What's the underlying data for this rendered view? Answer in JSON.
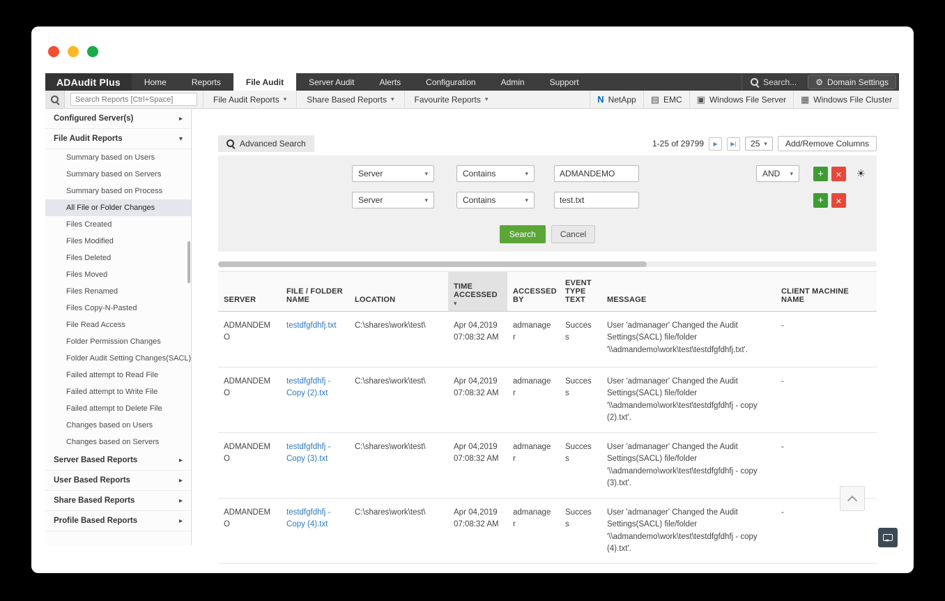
{
  "colors": {
    "accent_green": "#5ba637",
    "plus_green": "#3f9c35",
    "danger_red": "#e5493a",
    "link_blue": "#2e79bc",
    "nav_dark": "#3d3d3d",
    "selected_sidebar": "#e3e7eb",
    "netapp_blue": "#0067c5"
  },
  "nav": {
    "brand": "ADAudit Plus",
    "items": [
      {
        "label": "Home"
      },
      {
        "label": "Reports"
      },
      {
        "label": "File Audit",
        "active": true
      },
      {
        "label": "Server Audit"
      },
      {
        "label": "Alerts"
      },
      {
        "label": "Configuration"
      },
      {
        "label": "Admin"
      },
      {
        "label": "Support"
      }
    ],
    "search_label": "Search...",
    "domain_settings_label": "Domain Settings"
  },
  "toolbar": {
    "report_search_placeholder": "Search Reports [Ctrl+Space]",
    "menus": [
      {
        "label": "File Audit Reports"
      },
      {
        "label": "Share Based Reports"
      },
      {
        "label": "Favourite Reports"
      }
    ],
    "server_filters": [
      {
        "label": "NetApp"
      },
      {
        "label": "EMC"
      },
      {
        "label": "Windows File Server"
      },
      {
        "label": "Windows File Cluster"
      }
    ]
  },
  "sidebar": {
    "sections": [
      {
        "label": "Configured Server(s)",
        "expanded": false
      },
      {
        "label": "File Audit Reports",
        "expanded": true
      },
      {
        "label": "Server Based Reports",
        "expanded": false
      },
      {
        "label": "User Based Reports",
        "expanded": false
      },
      {
        "label": "Share Based Reports",
        "expanded": false
      },
      {
        "label": "Profile Based Reports",
        "expanded": false
      }
    ],
    "file_audit_items": [
      "Summary based on Users",
      "Summary based on Servers",
      "Summary based on Process",
      "All File or Folder Changes",
      "Files Created",
      "Files Modified",
      "Files Deleted",
      "Files Moved",
      "Files Renamed",
      "Files Copy-N-Pasted",
      "File Read Access",
      "Folder Permission Changes",
      "Folder Audit Setting Changes(SACL)",
      "Failed attempt to Read File",
      "Failed attempt to Write File",
      "Failed attempt to Delete File",
      "Changes based on Users",
      "Changes based on Servers"
    ],
    "selected_item": "All File or Folder Changes"
  },
  "main": {
    "advanced_search_label": "Advanced Search",
    "pagination": {
      "range": "1-25 of 29799",
      "page_size": "25"
    },
    "add_remove_columns": "Add/Remove Columns",
    "filters": {
      "rows": [
        {
          "field": "Server",
          "operator": "Contains",
          "value": "ADMANDEMO",
          "conjunction": "AND"
        },
        {
          "field": "Server",
          "operator": "Contains",
          "value": "test.txt"
        }
      ],
      "search_label": "Search",
      "cancel_label": "Cancel"
    },
    "table": {
      "columns": [
        "SERVER",
        "FILE / FOLDER NAME",
        "LOCATION",
        "TIME ACCESSED",
        "ACCESSED BY",
        "EVENT TYPE TEXT",
        "MESSAGE",
        "CLIENT MACHINE NAME"
      ],
      "rows": [
        {
          "server": "ADMANDEMO",
          "file": "testdfgfdhfj.txt",
          "location": "C:\\shares\\work\\test\\",
          "time": "Apr 04,2019 07:08:32 AM",
          "accessed_by": "admanager",
          "event_type": "Success",
          "message": "User 'admanager' Changed the Audit Settings(SACL) file/folder '\\\\admandemo\\work\\test\\testdfgfdhfj.txt'.",
          "client": "-"
        },
        {
          "server": "ADMANDEMO",
          "file": "testdfgfdhfj - Copy (2).txt",
          "location": "C:\\shares\\work\\test\\",
          "time": "Apr 04,2019 07:08:32 AM",
          "accessed_by": "admanager",
          "event_type": "Success",
          "message": "User 'admanager' Changed the Audit Settings(SACL) file/folder '\\\\admandemo\\work\\test\\testdfgfdhfj - copy (2).txt'.",
          "client": "-"
        },
        {
          "server": "ADMANDEMO",
          "file": "testdfgfdhfj - Copy (3).txt",
          "location": "C:\\shares\\work\\test\\",
          "time": "Apr 04,2019 07:08:32 AM",
          "accessed_by": "admanager",
          "event_type": "Success",
          "message": "User 'admanager' Changed the Audit Settings(SACL) file/folder '\\\\admandemo\\work\\test\\testdfgfdhfj - copy (3).txt'.",
          "client": "-"
        },
        {
          "server": "ADMANDEMO",
          "file": "testdfgfdhfj - Copy (4).txt",
          "location": "C:\\shares\\work\\test\\",
          "time": "Apr 04,2019 07:08:32 AM",
          "accessed_by": "admanager",
          "event_type": "Success",
          "message": "User 'admanager' Changed the Audit Settings(SACL) file/folder '\\\\admandemo\\work\\test\\testdfgfdhfj - copy (4).txt'.",
          "client": "-"
        }
      ]
    }
  }
}
